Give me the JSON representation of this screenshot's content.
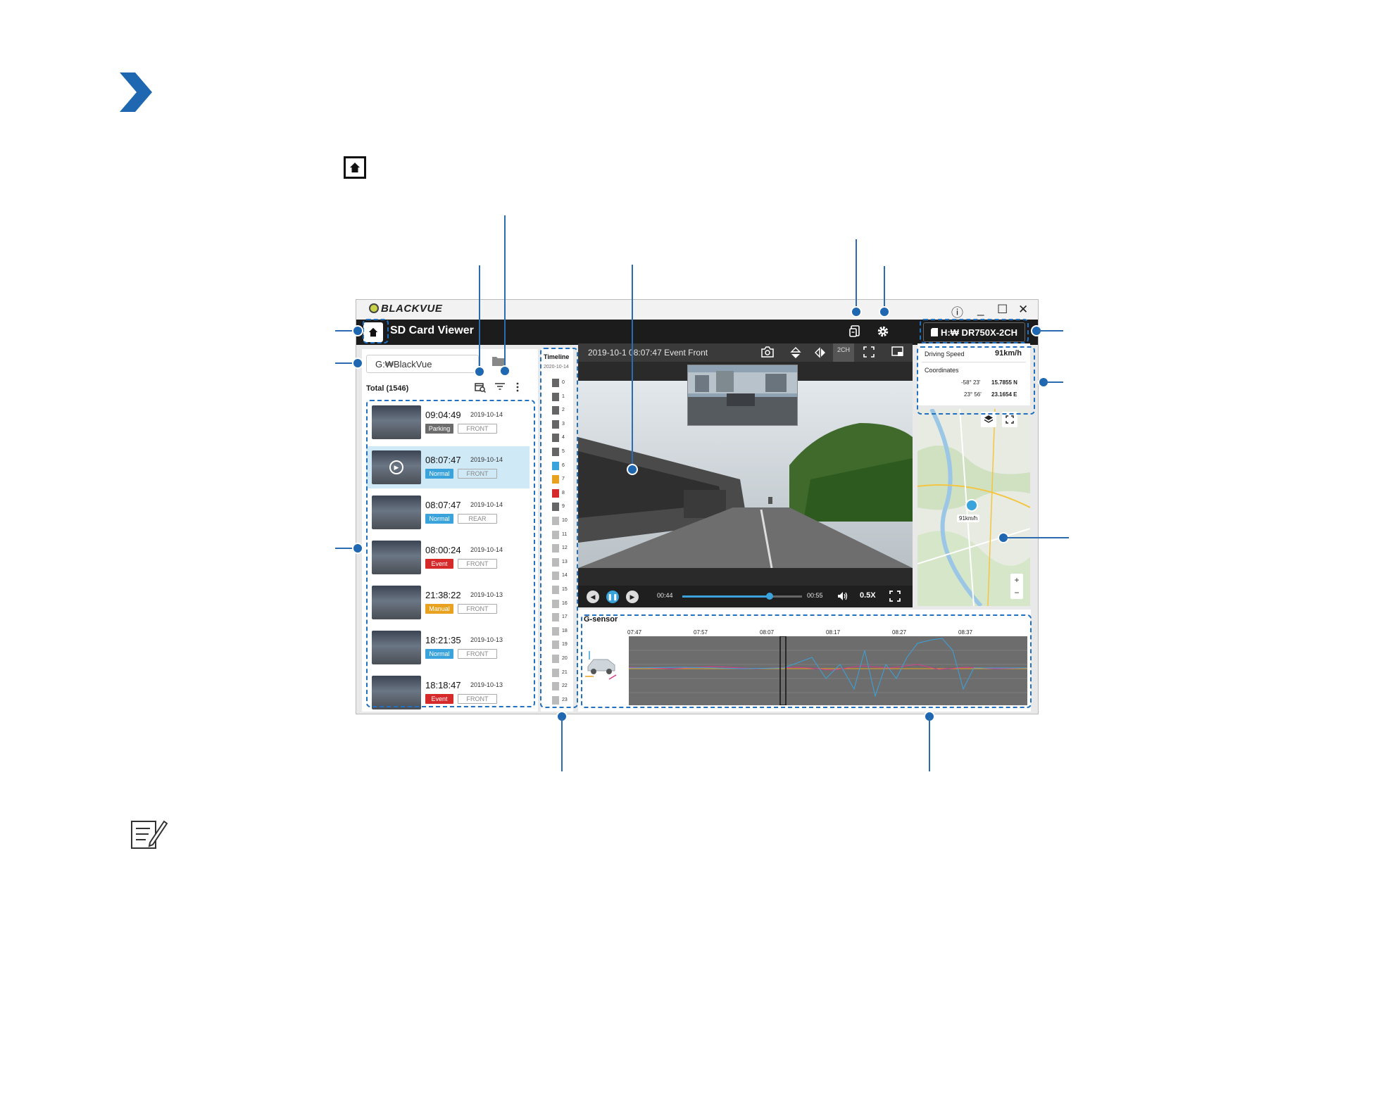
{
  "window": {
    "brand": "BLACKVUE",
    "title": "SD Card Viewer",
    "controls": [
      "ⓘ",
      "_",
      "☐",
      "✕"
    ]
  },
  "header": {
    "drive_label": "H:₩ DR750X-2CH"
  },
  "left_panel": {
    "path": "G:₩BlackVue",
    "total": "Total (1546)",
    "items": [
      {
        "time": "09:04:49",
        "date": "2019-10-14",
        "type": "Parking",
        "type_color": "#6b6b6b",
        "camera": "FRONT",
        "selected": false
      },
      {
        "time": "08:07:47",
        "date": "2019-10-14",
        "type": "Normal",
        "type_color": "#3aa3db",
        "camera": "FRONT",
        "selected": true
      },
      {
        "time": "08:07:47",
        "date": "2019-10-14",
        "type": "Normal",
        "type_color": "#3aa3db",
        "camera": "REAR",
        "selected": false
      },
      {
        "time": "08:00:24",
        "date": "2019-10-14",
        "type": "Event",
        "type_color": "#d62a2a",
        "camera": "FRONT",
        "selected": false
      },
      {
        "time": "21:38:22",
        "date": "2019-10-13",
        "type": "Manual",
        "type_color": "#e9a21f",
        "camera": "FRONT",
        "selected": false
      },
      {
        "time": "18:21:35",
        "date": "2019-10-13",
        "type": "Normal",
        "type_color": "#3aa3db",
        "camera": "FRONT",
        "selected": false
      },
      {
        "time": "18:18:47",
        "date": "2019-10-13",
        "type": "Event",
        "type_color": "#d62a2a",
        "camera": "FRONT",
        "selected": false
      }
    ]
  },
  "timeline": {
    "title": "Timeline",
    "date": "2020-10-14",
    "hours": [
      "0",
      "1",
      "2",
      "3",
      "4",
      "5",
      "6",
      "7",
      "8",
      "9",
      "10",
      "11",
      "12",
      "13",
      "14",
      "15",
      "16",
      "17",
      "18",
      "19",
      "20",
      "21",
      "22",
      "23"
    ],
    "colors": [
      "#666",
      "#666",
      "#666",
      "#666",
      "#666",
      "#666",
      "#3aa3db",
      "#e9a21f",
      "#d62a2a",
      "#666",
      "#bbb",
      "#bbb",
      "#bbb",
      "#bbb",
      "#bbb",
      "#bbb",
      "#bbb",
      "#bbb",
      "#bbb",
      "#bbb",
      "#bbb",
      "#bbb",
      "#bbb",
      "#bbb"
    ]
  },
  "video": {
    "title": "2019-10-1  08:07:47 Event Front",
    "mode": "2CH",
    "current_time": "00:44",
    "end_time": "00:55",
    "speed": "0.5X",
    "progress": 0.73
  },
  "info": {
    "speed_label": "Driving Speed",
    "speed_value": "91km/h",
    "coord_label": "Coordinates",
    "lat_deg": "-58° 23'",
    "lat_min": "15.7855 N",
    "lon_deg": "23° 56'",
    "lon_min": "23.1654 E"
  },
  "map": {
    "marker_label": "91km/h",
    "zoom_in": "+",
    "zoom_out": "−"
  },
  "gsensor": {
    "title": "G-sensor",
    "ticks": [
      "07:47",
      "07:57",
      "08:07",
      "08:17",
      "08:27",
      "08:37"
    ]
  },
  "colors": {
    "accent": "#1f67b1",
    "callout": "#2270c0"
  }
}
